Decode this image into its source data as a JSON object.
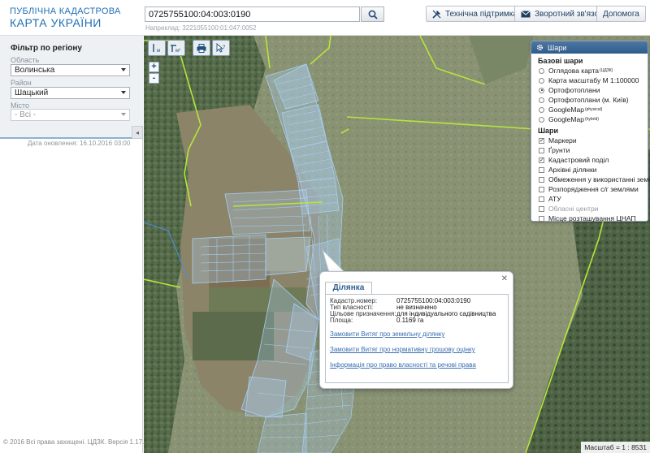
{
  "header": {
    "logo_line1": "ПУБЛІЧНА КАДАСТРОВА",
    "logo_line2": "КАРТА УКРАЇНИ",
    "search_value": "0725755100:04:003:0190",
    "search_hint": "Наприклад: 3221055100:01:047:0052",
    "support_label": "Технічна підтримка",
    "feedback_label": "Зворотний зв'язок",
    "help_label": "Допомога"
  },
  "sidebar": {
    "filter_title": "Фільтр по регіону",
    "region_label": "Область",
    "region_value": "Волинська",
    "district_label": "Район",
    "district_value": "Шацький",
    "city_label": "Місто",
    "city_value": "- Всі -",
    "update_date": "Дата оновлення: 16.10.2016 03:00",
    "copyright": "© 2016 Всі права захищені. ЦДЗК. Версія 1.17."
  },
  "map": {
    "zoom_in": "+",
    "zoom_out": "-",
    "scale": "Масштаб = 1 : 8531"
  },
  "layers": {
    "title": "Шари",
    "base_title": "Базові шари",
    "base": [
      {
        "label": "Оглядова карта",
        "sup": "(ЦДЗК)",
        "selected": false
      },
      {
        "label": "Карта масштабу М 1:100000",
        "sup": "",
        "selected": false
      },
      {
        "label": "Ортофотоплани",
        "sup": "",
        "selected": true
      },
      {
        "label": "Ортофотоплани (м. Київ)",
        "sup": "",
        "selected": false
      },
      {
        "label": "GoogleMap",
        "sup": "(physical)",
        "selected": false
      },
      {
        "label": "GoogleMap",
        "sup": "(hybrid)",
        "selected": false
      }
    ],
    "overlay_title": "Шари",
    "overlays": [
      {
        "label": "Маркери",
        "checked": true,
        "disabled": false
      },
      {
        "label": "Ґрунти",
        "checked": false,
        "disabled": false
      },
      {
        "label": "Кадастровий поділ",
        "checked": true,
        "disabled": false
      },
      {
        "label": "Архівні ділянки",
        "checked": false,
        "disabled": false
      },
      {
        "label": "Обмеження у використанні земель",
        "checked": false,
        "disabled": false
      },
      {
        "label": "Розпорядження с/г землями",
        "checked": false,
        "disabled": false
      },
      {
        "label": "АТУ",
        "checked": false,
        "disabled": false
      },
      {
        "label": "Обласні центри",
        "checked": false,
        "disabled": true
      },
      {
        "label": "Місце розташування ЦНАП",
        "checked": false,
        "disabled": false
      }
    ]
  },
  "popup": {
    "tab": "Ділянка",
    "cadastral_label": "Кадастр.номер:",
    "cadastral_value": "0725755100:04:003:0190",
    "ownership_label": "Тип власності:",
    "ownership_value": "не визначено",
    "purpose_label": "Цільове призначення:",
    "purpose_value": "для індивідуального садівництва",
    "area_label": "Площа:",
    "area_value": "0.1169 га",
    "link1": "Замовити Витяг про земельну ділянку",
    "link2": "Замовити Витяг про нормативну грошову оцінку",
    "link3": "Інформація про право власності та речові права"
  }
}
